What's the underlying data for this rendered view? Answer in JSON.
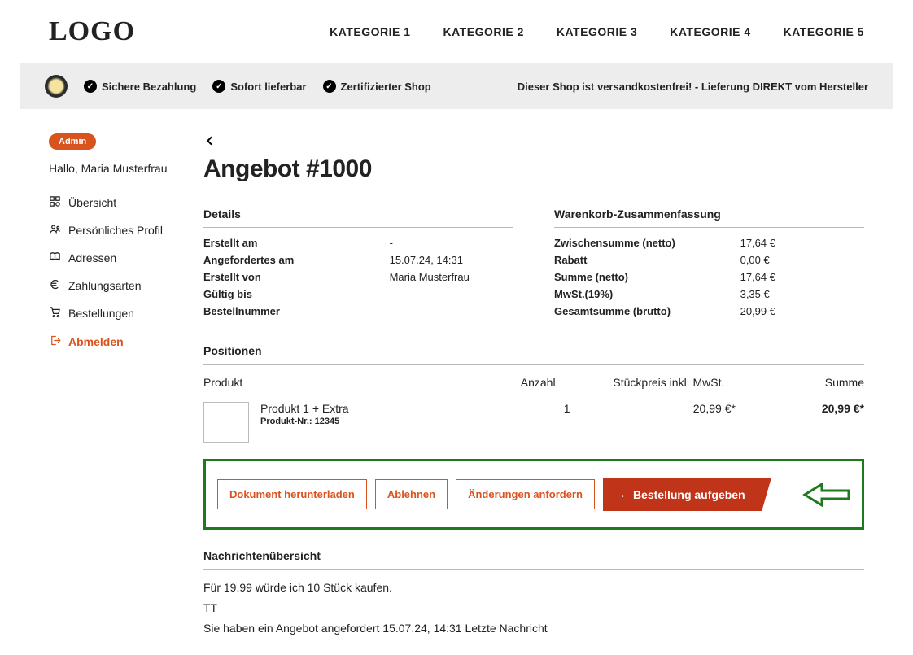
{
  "logo": "LOGO",
  "nav": [
    "KATEGORIE 1",
    "KATEGORIE 2",
    "KATEGORIE 3",
    "KATEGORIE 4",
    "KATEGORIE 5"
  ],
  "benefits": [
    "Sichere Bezahlung",
    "Sofort lieferbar",
    "Zertifizierter Shop"
  ],
  "ship_info": "Dieser Shop ist versandkostenfrei! - Lieferung DIREKT vom Hersteller",
  "sidebar": {
    "admin_badge": "Admin",
    "greeting": "Hallo, Maria Musterfrau",
    "menu": [
      {
        "icon": "overview",
        "label": "Übersicht"
      },
      {
        "icon": "profile",
        "label": "Persönliches Profil"
      },
      {
        "icon": "address",
        "label": "Adressen"
      },
      {
        "icon": "payment",
        "label": "Zahlungsarten"
      },
      {
        "icon": "orders",
        "label": "Bestellungen"
      },
      {
        "icon": "logout",
        "label": "Abmelden"
      }
    ]
  },
  "page_title": "Angebot #1000",
  "details": {
    "title": "Details",
    "rows": [
      {
        "label": "Erstellt am",
        "value": "-"
      },
      {
        "label": "Angefordertes am",
        "value": "15.07.24, 14:31"
      },
      {
        "label": "Erstellt von",
        "value": "Maria Musterfrau"
      },
      {
        "label": "Gültig bis",
        "value": "-"
      },
      {
        "label": "Bestellnummer",
        "value": "-"
      }
    ]
  },
  "cart_summary": {
    "title": "Warenkorb-Zusammenfassung",
    "rows": [
      {
        "label": "Zwischensumme (netto)",
        "value": "17,64 €"
      },
      {
        "label": "Rabatt",
        "value": "0,00 €"
      },
      {
        "label": "Summe (netto)",
        "value": "17,64 €"
      },
      {
        "label": "MwSt.(19%)",
        "value": "3,35 €"
      },
      {
        "label": "Gesamtsumme (brutto)",
        "value": "20,99 €"
      }
    ]
  },
  "positions": {
    "title": "Positionen",
    "header": {
      "product": "Produkt",
      "qty": "Anzahl",
      "price": "Stückpreis inkl. MwSt.",
      "sum": "Summe"
    },
    "items": [
      {
        "name": "Produkt 1 + Extra",
        "sku": "Produkt-Nr.: 12345",
        "qty": "1",
        "price": "20,99 €*",
        "sum": "20,99 €*"
      }
    ]
  },
  "actions": {
    "download": "Dokument herunterladen",
    "decline": "Ablehnen",
    "request_changes": "Änderungen anfordern",
    "place_order": "Bestellung aufgeben"
  },
  "messages": {
    "title": "Nachrichtenübersicht",
    "lines": [
      "Für 19,99 würde ich 10 Stück kaufen.",
      "TT",
      "Sie haben ein Angebot angefordert 15.07.24, 14:31 Letzte Nachricht"
    ]
  }
}
